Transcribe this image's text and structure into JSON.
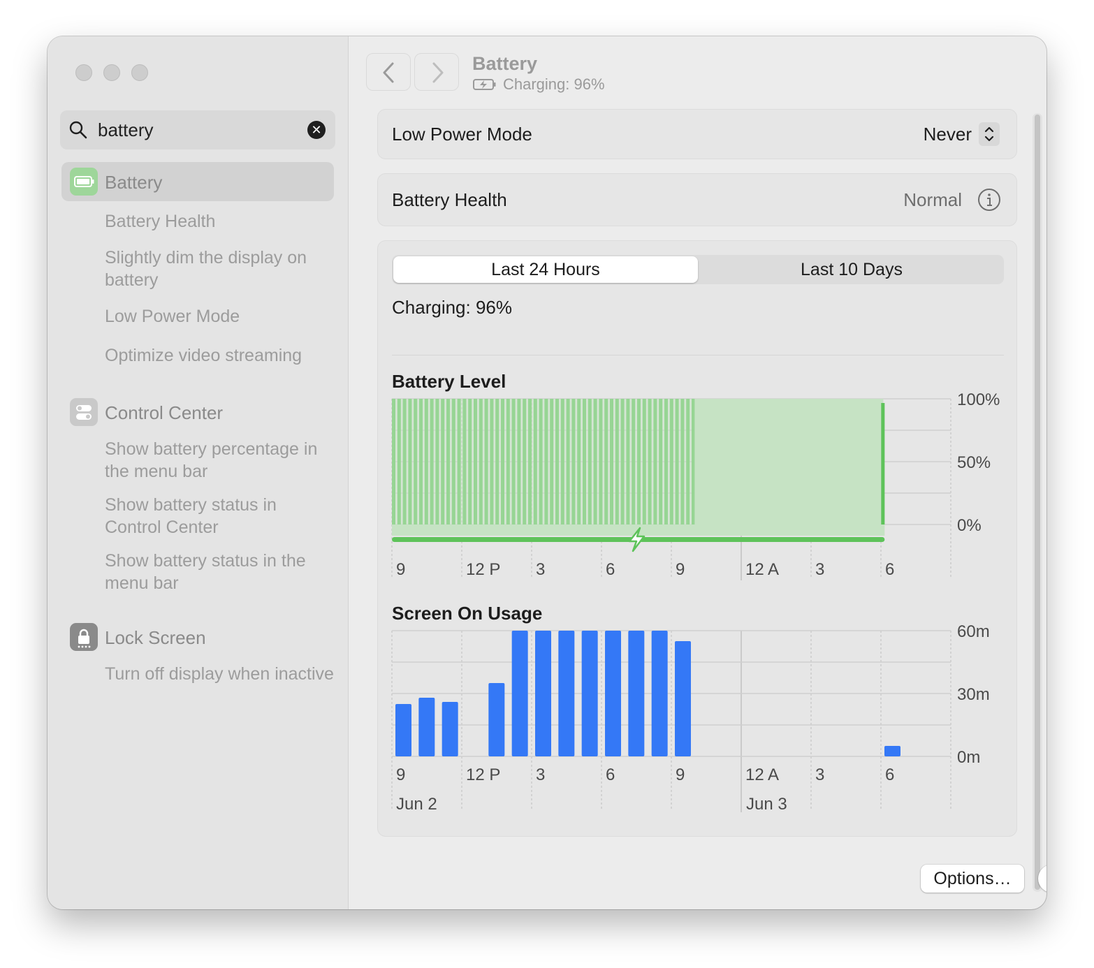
{
  "window": {
    "title": "Battery",
    "subtitle": "Charging: 96%"
  },
  "search": {
    "value": "battery",
    "clear_icon": "xmark-circle-icon"
  },
  "sidebar": {
    "battery": {
      "label": "Battery",
      "items": [
        "Battery Health",
        "Slightly dim the display on battery",
        "Low Power Mode",
        "Optimize video streaming"
      ]
    },
    "control_center": {
      "label": "Control Center",
      "items": [
        "Show battery percentage in the menu bar",
        "Show battery status in Control Center",
        "Show battery status in the menu bar"
      ]
    },
    "lock_screen": {
      "label": "Lock Screen",
      "items": [
        "Turn off display when inactive"
      ]
    }
  },
  "low_power": {
    "label": "Low Power Mode",
    "value": "Never"
  },
  "health": {
    "label": "Battery Health",
    "value": "Normal"
  },
  "tabs": {
    "active": "Last 24 Hours",
    "inactive": "Last 10 Days"
  },
  "status": "Charging: 96%",
  "colors": {
    "battery_green": "#5ec35a",
    "battery_fill": "#c6e3c4",
    "usage_blue": "#3478f6"
  },
  "chart_data": [
    {
      "type": "bar",
      "title": "Battery Level",
      "x_tick_labels": [
        "9",
        "12 P",
        "3",
        "6",
        "9",
        "12 A",
        "3",
        "6"
      ],
      "y_tick_labels": [
        "100%",
        "50%",
        "0%"
      ],
      "ylim": [
        0,
        100
      ],
      "series": [
        {
          "segment": "Jun 2 9:00 - Jun 2 22:00",
          "values": [
            100
          ],
          "style": "dense bars"
        },
        {
          "segment": "Jun 2 22:00 - Jun 3 6:00",
          "values": [
            100
          ],
          "style": "filled area"
        }
      ],
      "charging_indicator": "Jun 2 9:00 - Jun 3 6:00"
    },
    {
      "type": "bar",
      "title": "Screen On Usage",
      "x_tick_labels": [
        "9",
        "12 P",
        "3",
        "6",
        "9",
        "12 A",
        "3",
        "6"
      ],
      "date_labels": [
        "Jun 2",
        "Jun 3"
      ],
      "y_tick_labels": [
        "60m",
        "30m",
        "0m"
      ],
      "ylim": [
        0,
        60
      ],
      "categories": [
        "9",
        "10",
        "11",
        "12",
        "1",
        "2",
        "3",
        "4",
        "5",
        "6",
        "7",
        "8",
        "9",
        "10",
        "11",
        "12",
        "1",
        "2",
        "3",
        "4",
        "5",
        "6"
      ],
      "values": [
        25,
        28,
        26,
        0,
        35,
        60,
        60,
        60,
        60,
        60,
        60,
        60,
        55,
        0,
        0,
        0,
        0,
        0,
        0,
        0,
        0,
        5
      ]
    }
  ],
  "footer": {
    "options": "Options…",
    "help": "?"
  }
}
